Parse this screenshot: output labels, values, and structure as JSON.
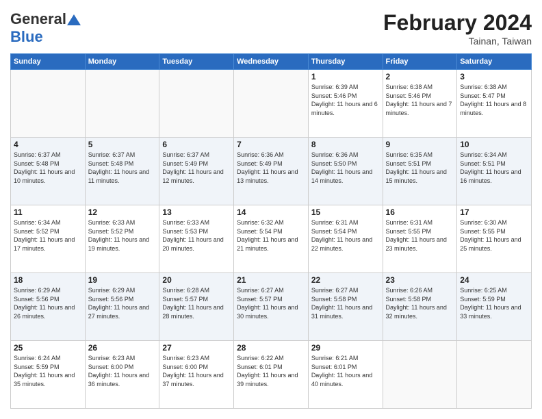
{
  "header": {
    "logo_general": "General",
    "logo_blue": "Blue",
    "title": "February 2024",
    "location": "Tainan, Taiwan"
  },
  "days_of_week": [
    "Sunday",
    "Monday",
    "Tuesday",
    "Wednesday",
    "Thursday",
    "Friday",
    "Saturday"
  ],
  "weeks": [
    [
      {
        "day": "",
        "info": ""
      },
      {
        "day": "",
        "info": ""
      },
      {
        "day": "",
        "info": ""
      },
      {
        "day": "",
        "info": ""
      },
      {
        "day": "1",
        "info": "Sunrise: 6:39 AM\nSunset: 5:46 PM\nDaylight: 11 hours and 6 minutes."
      },
      {
        "day": "2",
        "info": "Sunrise: 6:38 AM\nSunset: 5:46 PM\nDaylight: 11 hours and 7 minutes."
      },
      {
        "day": "3",
        "info": "Sunrise: 6:38 AM\nSunset: 5:47 PM\nDaylight: 11 hours and 8 minutes."
      }
    ],
    [
      {
        "day": "4",
        "info": "Sunrise: 6:37 AM\nSunset: 5:48 PM\nDaylight: 11 hours and 10 minutes."
      },
      {
        "day": "5",
        "info": "Sunrise: 6:37 AM\nSunset: 5:48 PM\nDaylight: 11 hours and 11 minutes."
      },
      {
        "day": "6",
        "info": "Sunrise: 6:37 AM\nSunset: 5:49 PM\nDaylight: 11 hours and 12 minutes."
      },
      {
        "day": "7",
        "info": "Sunrise: 6:36 AM\nSunset: 5:49 PM\nDaylight: 11 hours and 13 minutes."
      },
      {
        "day": "8",
        "info": "Sunrise: 6:36 AM\nSunset: 5:50 PM\nDaylight: 11 hours and 14 minutes."
      },
      {
        "day": "9",
        "info": "Sunrise: 6:35 AM\nSunset: 5:51 PM\nDaylight: 11 hours and 15 minutes."
      },
      {
        "day": "10",
        "info": "Sunrise: 6:34 AM\nSunset: 5:51 PM\nDaylight: 11 hours and 16 minutes."
      }
    ],
    [
      {
        "day": "11",
        "info": "Sunrise: 6:34 AM\nSunset: 5:52 PM\nDaylight: 11 hours and 17 minutes."
      },
      {
        "day": "12",
        "info": "Sunrise: 6:33 AM\nSunset: 5:52 PM\nDaylight: 11 hours and 19 minutes."
      },
      {
        "day": "13",
        "info": "Sunrise: 6:33 AM\nSunset: 5:53 PM\nDaylight: 11 hours and 20 minutes."
      },
      {
        "day": "14",
        "info": "Sunrise: 6:32 AM\nSunset: 5:54 PM\nDaylight: 11 hours and 21 minutes."
      },
      {
        "day": "15",
        "info": "Sunrise: 6:31 AM\nSunset: 5:54 PM\nDaylight: 11 hours and 22 minutes."
      },
      {
        "day": "16",
        "info": "Sunrise: 6:31 AM\nSunset: 5:55 PM\nDaylight: 11 hours and 23 minutes."
      },
      {
        "day": "17",
        "info": "Sunrise: 6:30 AM\nSunset: 5:55 PM\nDaylight: 11 hours and 25 minutes."
      }
    ],
    [
      {
        "day": "18",
        "info": "Sunrise: 6:29 AM\nSunset: 5:56 PM\nDaylight: 11 hours and 26 minutes."
      },
      {
        "day": "19",
        "info": "Sunrise: 6:29 AM\nSunset: 5:56 PM\nDaylight: 11 hours and 27 minutes."
      },
      {
        "day": "20",
        "info": "Sunrise: 6:28 AM\nSunset: 5:57 PM\nDaylight: 11 hours and 28 minutes."
      },
      {
        "day": "21",
        "info": "Sunrise: 6:27 AM\nSunset: 5:57 PM\nDaylight: 11 hours and 30 minutes."
      },
      {
        "day": "22",
        "info": "Sunrise: 6:27 AM\nSunset: 5:58 PM\nDaylight: 11 hours and 31 minutes."
      },
      {
        "day": "23",
        "info": "Sunrise: 6:26 AM\nSunset: 5:58 PM\nDaylight: 11 hours and 32 minutes."
      },
      {
        "day": "24",
        "info": "Sunrise: 6:25 AM\nSunset: 5:59 PM\nDaylight: 11 hours and 33 minutes."
      }
    ],
    [
      {
        "day": "25",
        "info": "Sunrise: 6:24 AM\nSunset: 5:59 PM\nDaylight: 11 hours and 35 minutes."
      },
      {
        "day": "26",
        "info": "Sunrise: 6:23 AM\nSunset: 6:00 PM\nDaylight: 11 hours and 36 minutes."
      },
      {
        "day": "27",
        "info": "Sunrise: 6:23 AM\nSunset: 6:00 PM\nDaylight: 11 hours and 37 minutes."
      },
      {
        "day": "28",
        "info": "Sunrise: 6:22 AM\nSunset: 6:01 PM\nDaylight: 11 hours and 39 minutes."
      },
      {
        "day": "29",
        "info": "Sunrise: 6:21 AM\nSunset: 6:01 PM\nDaylight: 11 hours and 40 minutes."
      },
      {
        "day": "",
        "info": ""
      },
      {
        "day": "",
        "info": ""
      }
    ]
  ]
}
